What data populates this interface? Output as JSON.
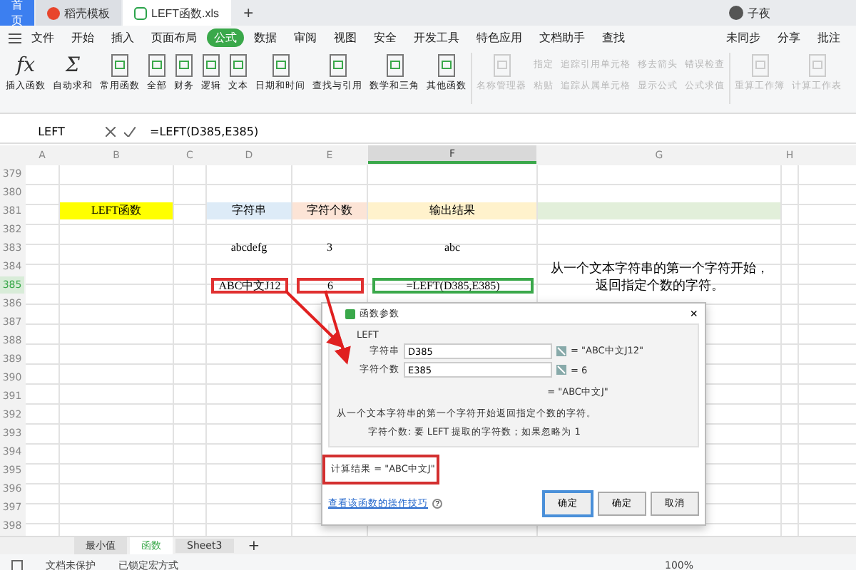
{
  "title_bar": {
    "tabs": [
      {
        "label": "首页",
        "selected": false,
        "kind": "home"
      },
      {
        "label": "稻壳模板",
        "selected": false,
        "kind": "docer"
      },
      {
        "label": "LEFT函数.xls",
        "selected": true,
        "kind": "sheet"
      }
    ],
    "add": "+",
    "user": "子夜"
  },
  "menu": {
    "items": [
      {
        "label": "文件",
        "selected": false
      },
      {
        "label": "开始",
        "selected": false
      },
      {
        "label": "插入",
        "selected": false
      },
      {
        "label": "页面布局",
        "selected": false
      },
      {
        "label": "公式",
        "selected": true
      },
      {
        "label": "数据",
        "selected": false
      },
      {
        "label": "审阅",
        "selected": false
      },
      {
        "label": "视图",
        "selected": false
      },
      {
        "label": "安全",
        "selected": false
      },
      {
        "label": "开发工具",
        "selected": false
      },
      {
        "label": "特色应用",
        "selected": false
      },
      {
        "label": "文档助手",
        "selected": false
      },
      {
        "label": "查找",
        "selected": false
      }
    ],
    "right": [
      "未同步",
      "分享",
      "批注"
    ]
  },
  "ribbon": [
    {
      "kind": "large",
      "label": "插入函数",
      "glyph": "fx",
      "disabled": false
    },
    {
      "kind": "large",
      "label": "自动求和",
      "glyph": "Σ",
      "disabled": false
    },
    {
      "kind": "large",
      "label": "常用函数",
      "disabled": false
    },
    {
      "kind": "large",
      "label": "全部",
      "disabled": false
    },
    {
      "kind": "large",
      "label": "财务",
      "disabled": false
    },
    {
      "kind": "large",
      "label": "逻辑",
      "disabled": false
    },
    {
      "kind": "large",
      "label": "文本",
      "disabled": false
    },
    {
      "kind": "large",
      "label": "日期和时间",
      "disabled": false
    },
    {
      "kind": "large",
      "label": "查找与引用",
      "disabled": false
    },
    {
      "kind": "large",
      "label": "数学和三角",
      "disabled": false
    },
    {
      "kind": "large",
      "label": "其他函数",
      "disabled": false
    },
    {
      "kind": "large",
      "label": "名称管理器",
      "disabled": true
    },
    {
      "kind": "stack",
      "items": [
        {
          "label": "指定",
          "disabled": true
        },
        {
          "label": "粘贴",
          "disabled": true
        }
      ]
    },
    {
      "kind": "stack",
      "items": [
        {
          "label": "追踪引用单元格",
          "disabled": true
        },
        {
          "label": "追踪从属单元格",
          "disabled": true
        }
      ]
    },
    {
      "kind": "stack",
      "items": [
        {
          "label": "移去箭头",
          "disabled": true
        },
        {
          "label": "显示公式",
          "disabled": true
        }
      ]
    },
    {
      "kind": "stack",
      "items": [
        {
          "label": "错误检查",
          "disabled": true
        },
        {
          "label": "公式求值",
          "disabled": true
        }
      ]
    },
    {
      "kind": "large",
      "label": "重算工作簿",
      "disabled": true
    },
    {
      "kind": "large",
      "label": "计算工作表",
      "disabled": true
    }
  ],
  "formula_bar": {
    "name_box": "LEFT",
    "formula": "=LEFT(D385,E385)"
  },
  "sheet": {
    "columns": [
      {
        "label": "A",
        "selected": false
      },
      {
        "label": "B",
        "selected": false
      },
      {
        "label": "C",
        "selected": false
      },
      {
        "label": "D",
        "selected": false
      },
      {
        "label": "E",
        "selected": false
      },
      {
        "label": "F",
        "selected": true
      },
      {
        "label": "G",
        "selected": false
      },
      {
        "label": "H",
        "selected": false
      }
    ],
    "rows": [
      {
        "number": "379",
        "selected": false,
        "cells": []
      },
      {
        "number": "380",
        "selected": false,
        "cells": []
      },
      {
        "number": "381",
        "selected": false,
        "cells": [
          {
            "text": ""
          },
          {
            "text": "LEFT函数",
            "color": "#ffff00"
          },
          {
            "text": ""
          },
          {
            "text": "字符串",
            "color": "#ddebf7"
          },
          {
            "text": "字符个数",
            "color": "#fce4d6"
          },
          {
            "text": "输出结果",
            "color": "#fff2cc"
          },
          {
            "text": "",
            "color": "#e2efda"
          }
        ]
      },
      {
        "number": "382",
        "selected": false,
        "cells": []
      },
      {
        "number": "383",
        "selected": false,
        "cells": [
          {
            "text": ""
          },
          {
            "text": ""
          },
          {
            "text": ""
          },
          {
            "text": "abcdefg"
          },
          {
            "text": "3"
          },
          {
            "text": "abc"
          }
        ]
      },
      {
        "number": "384",
        "selected": false,
        "cells": [
          {
            "text": ""
          },
          {
            "text": ""
          },
          {
            "text": ""
          },
          {
            "text": ""
          },
          {
            "text": ""
          },
          {
            "text": ""
          },
          {
            "text": "从一个文本字符串的第一个字符开始，返回指定个数的字符。"
          }
        ]
      },
      {
        "number": "385",
        "selected": true,
        "cells": [
          {
            "text": ""
          },
          {
            "text": ""
          },
          {
            "text": ""
          },
          {
            "text": "ABC中文J12",
            "boxed": true
          },
          {
            "text": "6",
            "boxed": true
          },
          {
            "text": "=LEFT(D385,E385)",
            "boxed": true
          }
        ]
      },
      {
        "number": "386",
        "selected": false,
        "cells": []
      },
      {
        "number": "387",
        "selected": false,
        "cells": []
      },
      {
        "number": "388",
        "selected": false,
        "cells": []
      },
      {
        "number": "389",
        "selected": false,
        "cells": []
      },
      {
        "number": "390",
        "selected": false,
        "cells": []
      },
      {
        "number": "391",
        "selected": false,
        "cells": []
      },
      {
        "number": "392",
        "selected": false,
        "cells": []
      },
      {
        "number": "393",
        "selected": false,
        "cells": []
      },
      {
        "number": "394",
        "selected": false,
        "cells": []
      },
      {
        "number": "395",
        "selected": false,
        "cells": []
      },
      {
        "number": "396",
        "selected": false,
        "cells": []
      },
      {
        "number": "397",
        "selected": false,
        "cells": []
      },
      {
        "number": "398",
        "selected": false,
        "cells": []
      }
    ]
  },
  "dialog": {
    "title": "函数参数",
    "close": "×",
    "function_name": "LEFT",
    "args": [
      {
        "label": "字符串",
        "value": "D385",
        "result": "= \"ABC中文J12\""
      },
      {
        "label": "字符个数",
        "value": "E385",
        "result": "= 6"
      }
    ],
    "result": "= \"ABC中文J\"",
    "description": "从一个文本字符串的第一个字符开始返回指定个数的字符。",
    "arg_help": "字符个数:  要 LEFT 提取的字符数；如果忽略为 1",
    "calc_result": "计算结果 = \"ABC中文J\"",
    "help_link": "查看该函数的操作技巧",
    "help_icon": "?",
    "buttons": [
      {
        "label": "确定",
        "selected": true
      },
      {
        "label": "确定",
        "selected": false
      },
      {
        "label": "取消",
        "selected": false
      }
    ]
  },
  "sheet_tabs": {
    "tabs": [
      {
        "label": "最小值",
        "selected": false
      },
      {
        "label": "函数",
        "selected": true
      },
      {
        "label": "Sheet3",
        "selected": false
      }
    ],
    "add": "+"
  },
  "status_bar": {
    "items": [
      "文档未保护",
      "已锁定宏方式"
    ],
    "zoom": "100%"
  }
}
